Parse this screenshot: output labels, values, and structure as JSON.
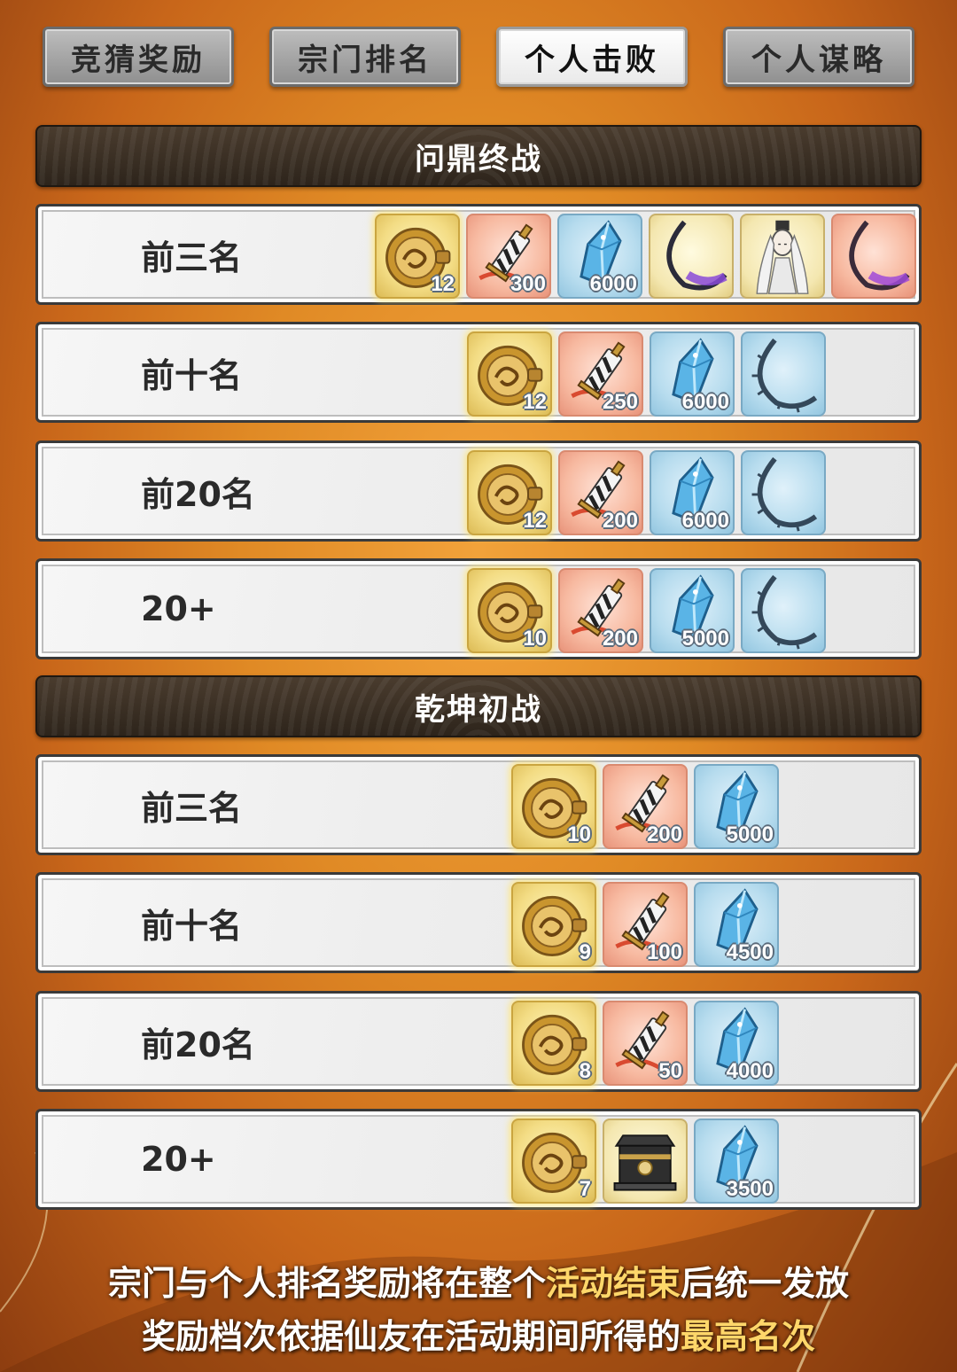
{
  "tabs": [
    {
      "label": "竞猜奖励",
      "active": false
    },
    {
      "label": "宗门排名",
      "active": false
    },
    {
      "label": "个人击败",
      "active": true
    },
    {
      "label": "个人谋略",
      "active": false
    }
  ],
  "sections": [
    {
      "title": "问鼎终战",
      "rows": [
        {
          "rank": "前三名",
          "items": [
            {
              "icon": "dragon-coin-icon",
              "type": "gold",
              "count": "12"
            },
            {
              "icon": "sword-token-icon",
              "type": "red",
              "count": "300"
            },
            {
              "icon": "spirit-crystal-icon",
              "type": "blue",
              "count": "6000"
            },
            {
              "icon": "purple-crescent-blade-icon",
              "type": "yellow",
              "count": ""
            },
            {
              "icon": "immortal-character-portrait-icon",
              "type": "yellow",
              "count": ""
            },
            {
              "icon": "purple-crescent-blade-red-icon",
              "type": "red",
              "count": ""
            }
          ]
        },
        {
          "rank": "前十名",
          "items": [
            {
              "icon": "dragon-coin-icon",
              "type": "gold",
              "count": "12"
            },
            {
              "icon": "sword-token-icon",
              "type": "red",
              "count": "250"
            },
            {
              "icon": "spirit-crystal-icon",
              "type": "blue",
              "count": "6000"
            },
            {
              "icon": "thorn-crescent-blade-icon",
              "type": "blue",
              "count": ""
            }
          ]
        },
        {
          "rank": "前20名",
          "items": [
            {
              "icon": "dragon-coin-icon",
              "type": "gold",
              "count": "12"
            },
            {
              "icon": "sword-token-icon",
              "type": "red",
              "count": "200"
            },
            {
              "icon": "spirit-crystal-icon",
              "type": "blue",
              "count": "6000"
            },
            {
              "icon": "thorn-crescent-blade-icon",
              "type": "blue",
              "count": ""
            }
          ]
        },
        {
          "rank": "20+",
          "items": [
            {
              "icon": "dragon-coin-icon",
              "type": "gold",
              "count": "10"
            },
            {
              "icon": "sword-token-icon",
              "type": "red",
              "count": "200"
            },
            {
              "icon": "spirit-crystal-icon",
              "type": "blue",
              "count": "5000"
            },
            {
              "icon": "thorn-crescent-blade-icon",
              "type": "blue",
              "count": ""
            }
          ]
        }
      ]
    },
    {
      "title": "乾坤初战",
      "rows": [
        {
          "rank": "前三名",
          "items": [
            {
              "icon": "dragon-coin-icon",
              "type": "gold",
              "count": "10"
            },
            {
              "icon": "sword-token-icon",
              "type": "red",
              "count": "200"
            },
            {
              "icon": "spirit-crystal-icon",
              "type": "blue",
              "count": "5000"
            }
          ]
        },
        {
          "rank": "前十名",
          "items": [
            {
              "icon": "dragon-coin-icon",
              "type": "gold",
              "count": "9"
            },
            {
              "icon": "sword-token-icon",
              "type": "red",
              "count": "100"
            },
            {
              "icon": "spirit-crystal-icon",
              "type": "blue",
              "count": "4500"
            }
          ]
        },
        {
          "rank": "前20名",
          "items": [
            {
              "icon": "dragon-coin-icon",
              "type": "gold",
              "count": "8"
            },
            {
              "icon": "sword-token-icon",
              "type": "red",
              "count": "50"
            },
            {
              "icon": "spirit-crystal-icon",
              "type": "blue",
              "count": "4000"
            }
          ]
        },
        {
          "rank": "20+",
          "items": [
            {
              "icon": "dragon-coin-icon",
              "type": "gold",
              "count": "7"
            },
            {
              "icon": "treasure-chest-icon",
              "type": "yellow",
              "count": ""
            },
            {
              "icon": "spirit-crystal-icon",
              "type": "blue",
              "count": "3500"
            }
          ]
        }
      ]
    }
  ],
  "footer": {
    "line1_a": "宗门与个人排名奖励将在整个",
    "line1_hl": "活动结束",
    "line1_b": "后统一发放",
    "line2_a": "奖励档次依据仙友在活动期间所得的",
    "line2_hl": "最高名次"
  },
  "colors": {
    "highlight": "#ffd76a",
    "header_bg": "#2d241b",
    "background": "#e08a25"
  }
}
